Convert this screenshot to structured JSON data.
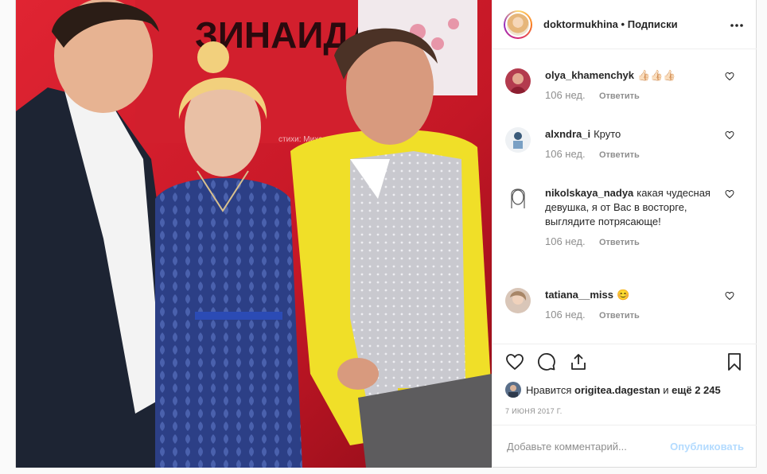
{
  "post": {
    "username": "doktormukhina",
    "separator": "•",
    "follow_label": "Подписки",
    "more_icon": "more-horizontal-icon"
  },
  "photo": {
    "backdrop_text": "ЗИНАИДА",
    "small_text": "стихи: Михаил Гуцериев"
  },
  "comments": [
    {
      "user": "olya_khamenchyk",
      "text": "👍🏻👍🏻👍🏻",
      "age": "106 нед.",
      "reply": "Ответить"
    },
    {
      "user": "alxndra_i",
      "text": "Круто",
      "age": "106 нед.",
      "reply": "Ответить"
    },
    {
      "user": "nikolskaya_nadya",
      "text": "какая чудесная девушка, я от Вас в восторге, выглядите потрясающе!",
      "age": "106 нед.",
      "reply": "Ответить"
    },
    {
      "user": "tatiana__miss",
      "text": "😊",
      "age": "106 нед.",
      "reply": "Ответить"
    }
  ],
  "likes": {
    "prefix": "Нравится",
    "user": "origitea.dagestan",
    "middle": "и",
    "others": "ещё 2 245"
  },
  "date": "7 ИЮНЯ 2017 Г.",
  "comment_box": {
    "placeholder": "Добавьте комментарий...",
    "publish_label": "Опубликовать"
  },
  "colors": {
    "accent": "#0095f6",
    "publish_disabled": "#b3dbff",
    "muted": "#8e8e8e",
    "border": "#dbdbdb"
  }
}
